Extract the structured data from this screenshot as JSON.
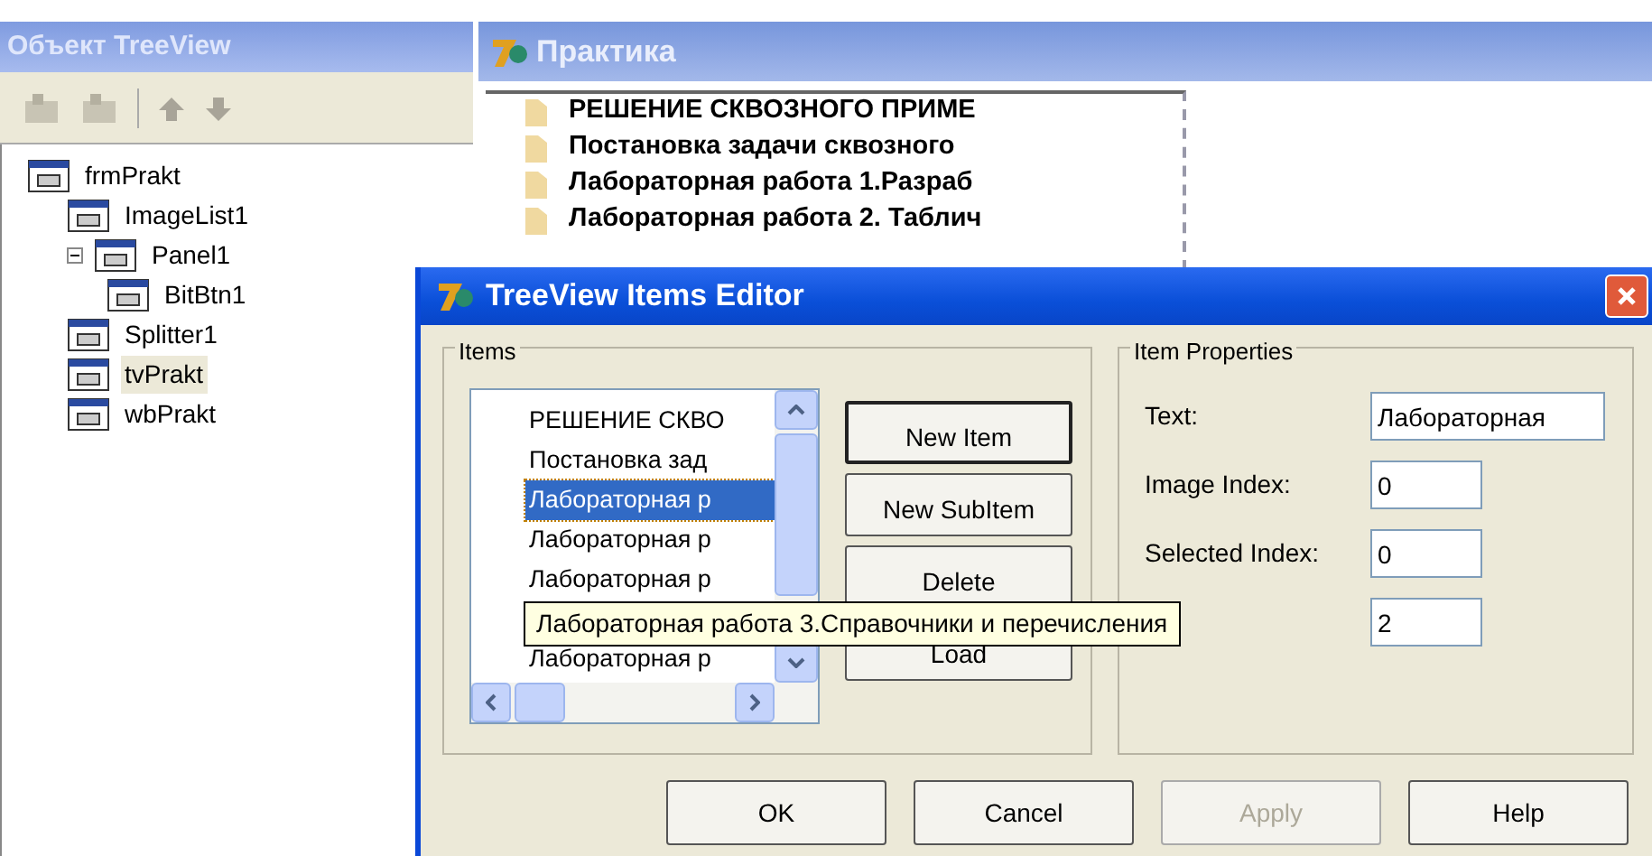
{
  "inspector": {
    "title": "Объект TreeView",
    "tree": [
      {
        "label": "frmPrakt",
        "selected": false,
        "children": [
          {
            "label": "ImageList1",
            "selected": false
          },
          {
            "label": "Panel1",
            "selected": false,
            "expanded": true,
            "children": [
              {
                "label": "BitBtn1",
                "selected": false
              }
            ]
          },
          {
            "label": "Splitter1",
            "selected": false
          },
          {
            "label": "tvPrakt",
            "selected": true
          },
          {
            "label": "wbPrakt",
            "selected": false
          }
        ]
      }
    ]
  },
  "form": {
    "title": "Практика",
    "items": [
      "РЕШЕНИЕ СКВОЗНОГО ПРИМЕ",
      "Постановка задачи сквозного",
      "Лабораторная работа 1.Разраб",
      "Лабораторная работа 2. Таблич"
    ]
  },
  "dialog": {
    "title": "TreeView Items Editor",
    "items_group": {
      "caption": "Items",
      "items": [
        {
          "label": "РЕШЕНИЕ СКВО",
          "selected": false
        },
        {
          "label": "Постановка зад",
          "selected": false
        },
        {
          "label": "Лабораторная р",
          "selected": true
        },
        {
          "label": "Лабораторная р",
          "selected": false
        },
        {
          "label": "Лабораторная р",
          "selected": false
        },
        {
          "label": "Лабораторная р",
          "selected": false
        }
      ]
    },
    "side_buttons": [
      {
        "label": "New Item",
        "default": true
      },
      {
        "label": "New SubItem",
        "default": false
      },
      {
        "label": "Delete",
        "default": false
      },
      {
        "label": "Load",
        "default": false
      }
    ],
    "properties": {
      "caption": "Item Properties",
      "fields": [
        {
          "label": "Text:",
          "value": "Лабораторная"
        },
        {
          "label": "Image Index:",
          "value": "0"
        },
        {
          "label": "Selected Index:",
          "value": "0"
        },
        {
          "value": "2"
        }
      ]
    },
    "tooltip": "Лабораторная работа 3.Справочники и перечисления",
    "buttons": [
      {
        "label": "OK",
        "disabled": false
      },
      {
        "label": "Cancel",
        "disabled": false
      },
      {
        "label": "Apply",
        "disabled": true
      },
      {
        "label": "Help",
        "disabled": false
      }
    ]
  }
}
